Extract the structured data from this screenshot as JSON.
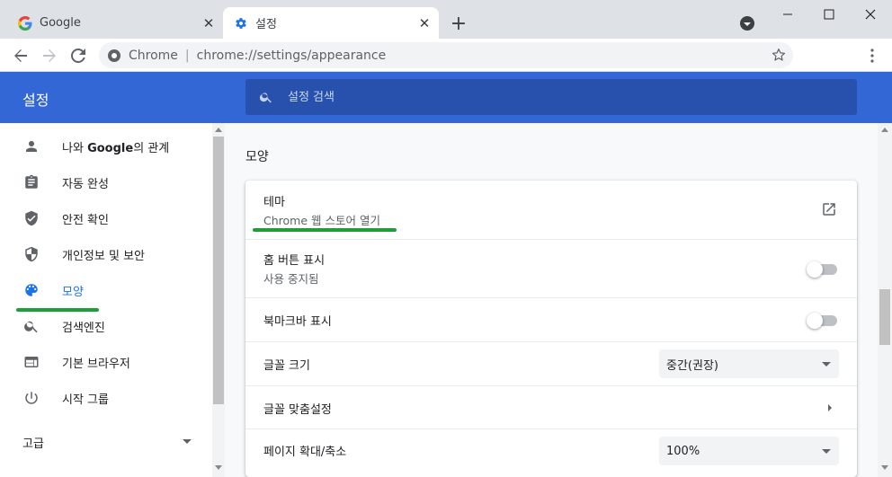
{
  "tabs": [
    {
      "title": "Google",
      "close": "✕"
    },
    {
      "title": "설정",
      "close": "✕"
    }
  ],
  "new_tab": "+",
  "toolbar": {
    "site_name": "Chrome",
    "separator": "|",
    "url": "chrome://settings/appearance"
  },
  "header": {
    "title": "설정",
    "search_placeholder": "설정 검색"
  },
  "sidebar": {
    "items": [
      {
        "label_pre": "나와 ",
        "label_bold": "Google",
        "label_post": "의 관계",
        "icon": "person-icon"
      },
      {
        "label": "자동 완성",
        "icon": "clipboard-icon"
      },
      {
        "label": "안전 확인",
        "icon": "shield-check-icon"
      },
      {
        "label": "개인정보 및 보안",
        "icon": "shield-half-icon"
      },
      {
        "label": "모양",
        "icon": "palette-icon",
        "active": true
      },
      {
        "label": "검색엔진",
        "icon": "search-icon"
      },
      {
        "label": "기본 브라우저",
        "icon": "browser-icon"
      },
      {
        "label": "시작 그룹",
        "icon": "power-icon"
      }
    ],
    "advanced": "고급"
  },
  "main": {
    "section_title": "모양",
    "theme": {
      "label": "테마",
      "sub": "Chrome 웹 스토어 열기"
    },
    "home_button": {
      "label": "홈 버튼 표시",
      "sub": "사용 중지됨",
      "enabled": false
    },
    "bookmarks_bar": {
      "label": "북마크바 표시",
      "enabled": false
    },
    "font_size": {
      "label": "글꼴 크기",
      "value": "중간(권장)"
    },
    "customize_fonts": {
      "label": "글꼴 맞춤설정"
    },
    "page_zoom": {
      "label": "페이지 확대/축소",
      "value": "100%"
    }
  },
  "colors": {
    "header_blue": "#3367d6",
    "search_blue": "#2850ad",
    "accent": "#1a73e8",
    "annotation_green": "#1e9e3a"
  }
}
